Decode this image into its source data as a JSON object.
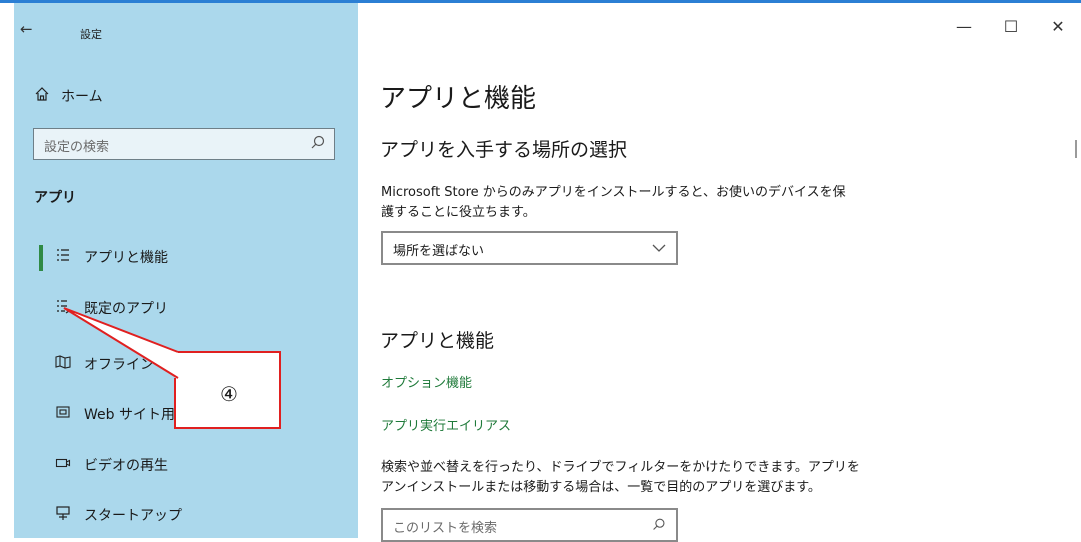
{
  "window": {
    "title": "設定",
    "back_icon": "←",
    "minimize_icon": "—",
    "maximize_icon": "☐",
    "close_icon": "✕"
  },
  "sidebar": {
    "home_label": "ホーム",
    "search_placeholder": "設定の検索",
    "section_title": "アプリ",
    "items": [
      {
        "label": "アプリと機能",
        "icon": "list-icon",
        "selected": true
      },
      {
        "label": "既定のアプリ",
        "icon": "default-apps-icon",
        "selected": false
      },
      {
        "label": "オフライン マップ",
        "icon": "map-icon",
        "selected": false
      },
      {
        "label": "Web サイト用のアプリ",
        "icon": "web-app-icon",
        "selected": false
      },
      {
        "label": "ビデオの再生",
        "icon": "video-icon",
        "selected": false
      },
      {
        "label": "スタートアップ",
        "icon": "startup-icon",
        "selected": false
      }
    ]
  },
  "main": {
    "page_title": "アプリと機能",
    "source_heading": "アプリを入手する場所の選択",
    "source_desc_line1": "Microsoft Store からのみアプリをインストールすると、お使いのデバイスを保",
    "source_desc_line2": "護することに役立ちます。",
    "source_dropdown_value": "場所を選ばない",
    "features_heading": "アプリと機能",
    "optional_features_link": "オプション機能",
    "app_alias_link": "アプリ実行エイリアス",
    "list_desc_line1": "検索や並べ替えを行ったり、ドライブでフィルターをかけたりできます。アプリを",
    "list_desc_line2": "アンインストールまたは移動する場合は、一覧で目的のアプリを選びます。",
    "list_search_placeholder": "このリストを検索"
  },
  "annotation": {
    "marker": "④"
  },
  "colors": {
    "sidebar_bg": "#abd8ec",
    "accent_green": "#1f7a3a",
    "callout_red": "#e02020"
  }
}
